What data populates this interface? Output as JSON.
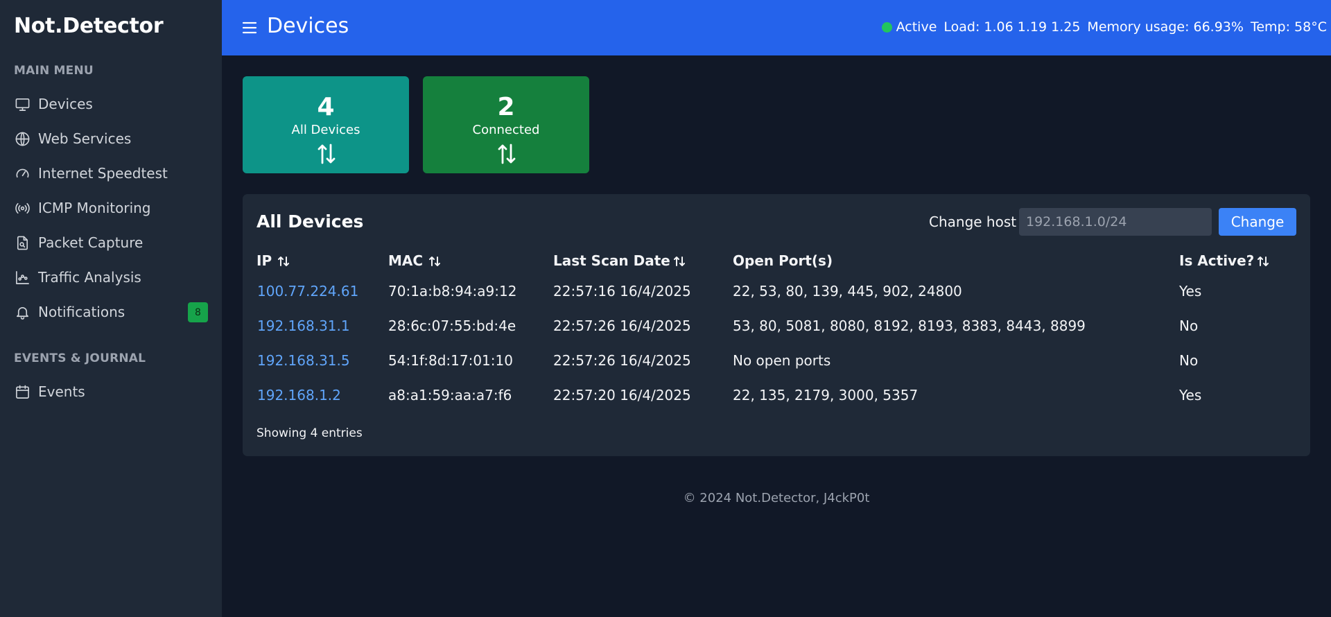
{
  "sidebar": {
    "brand": "Not.Detector",
    "sections": [
      {
        "label": "MAIN MENU"
      },
      {
        "label": "EVENTS & JOURNAL"
      }
    ],
    "items": [
      {
        "label": "Devices",
        "icon": "monitor-icon"
      },
      {
        "label": "Web Services",
        "icon": "globe-icon"
      },
      {
        "label": "Internet Speedtest",
        "icon": "gauge-icon"
      },
      {
        "label": "ICMP Monitoring",
        "icon": "broadcast-icon"
      },
      {
        "label": "Packet Capture",
        "icon": "file-search-icon"
      },
      {
        "label": "Traffic Analysis",
        "icon": "chart-icon"
      },
      {
        "label": "Notifications",
        "icon": "bell-icon",
        "badge": "8"
      },
      {
        "label": "Events",
        "icon": "calendar-icon"
      }
    ]
  },
  "header": {
    "title": "Devices",
    "status": "Active",
    "load": "Load: 1.06 1.19 1.25",
    "memory": "Memory usage: 66.93%",
    "temp": "Temp: 58°C"
  },
  "stats": [
    {
      "value": "4",
      "label": "All Devices",
      "color": "#0d9488"
    },
    {
      "value": "2",
      "label": "Connected",
      "color": "#15803d"
    }
  ],
  "panel": {
    "title": "All Devices",
    "host_label": "Change host",
    "host_placeholder": "192.168.1.0/24",
    "change_button": "Change",
    "columns": [
      "IP",
      "MAC",
      "Last Scan Date",
      "Open Port(s)",
      "Is Active?"
    ],
    "rows": [
      {
        "ip": "100.77.224.61",
        "mac": "70:1a:b8:94:a9:12",
        "date": "22:57:16 16/4/2025",
        "ports": "22, 53, 80, 139, 445, 902, 24800",
        "active": "Yes"
      },
      {
        "ip": "192.168.31.1",
        "mac": "28:6c:07:55:bd:4e",
        "date": "22:57:26 16/4/2025",
        "ports": "53, 80, 5081, 8080, 8192, 8193, 8383, 8443, 8899",
        "active": "No"
      },
      {
        "ip": "192.168.31.5",
        "mac": "54:1f:8d:17:01:10",
        "date": "22:57:26 16/4/2025",
        "ports": "No open ports",
        "active": "No"
      },
      {
        "ip": "192.168.1.2",
        "mac": "a8:a1:59:aa:a7:f6",
        "date": "22:57:20 16/4/2025",
        "ports": "22, 135, 2179, 3000, 5357",
        "active": "Yes"
      }
    ],
    "footer": "Showing 4 entries"
  },
  "copyright": "© 2024 Not.Detector, J4ckP0t",
  "colors": {
    "header": "#2563eb",
    "sidebar": "#1f2937",
    "background": "#111827",
    "link": "#60a5fa",
    "status_dot": "#22c55e"
  }
}
